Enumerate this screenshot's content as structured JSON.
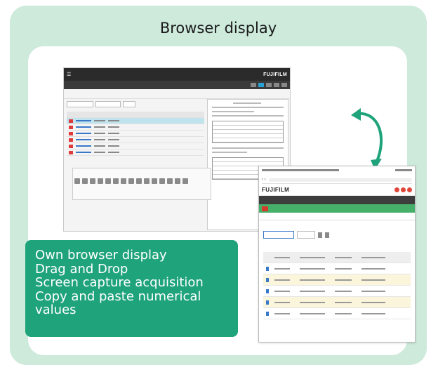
{
  "card": {
    "title": "Browser display"
  },
  "caption": {
    "lines": [
      "Own browser display",
      "Drag and Drop",
      "Screen capture acquisition",
      "Copy and paste numerical",
      "values"
    ]
  },
  "workspace_screenshot": {
    "brand": "FUJIFILM"
  },
  "browser_screenshot": {
    "brand": "FUJIFILM"
  },
  "colors": {
    "card_bg": "#cdeadb",
    "caption_bg": "#1fa37a",
    "arrow": "#1fa37a"
  },
  "icons": [
    "curved-double-arrow-icon"
  ]
}
